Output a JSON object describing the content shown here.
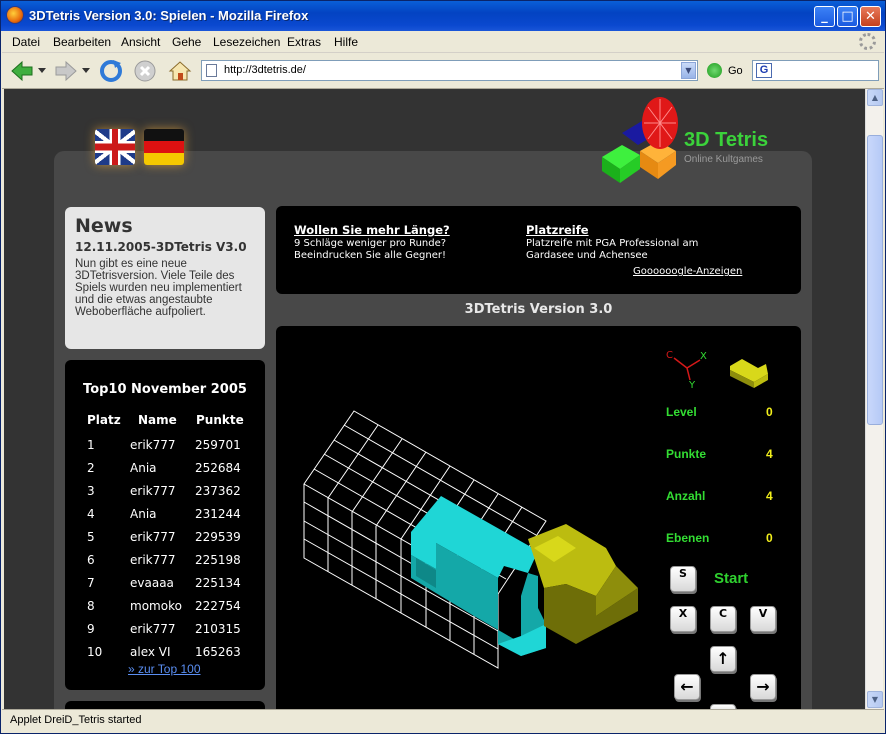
{
  "window": {
    "title": "3DTetris Version 3.0: Spielen - Mozilla Firefox",
    "btn_min": "_",
    "btn_max": "□",
    "btn_close": "✕"
  },
  "menu": [
    "Datei",
    "Bearbeiten",
    "Ansicht",
    "Gehe",
    "Lesezeichen",
    "Extras",
    "Hilfe"
  ],
  "toolbar": {
    "url": "http://3dtetris.de/",
    "go_label": "Go",
    "search_icon_text": "G"
  },
  "status": "Applet DreiD_Tetris started",
  "logo": {
    "title": "3D Tetris",
    "subtitle": "Online Kultgames"
  },
  "news": {
    "heading": "News",
    "date": "12.11.2005-3DTetris V3.0",
    "body": "Nun gibt es eine neue 3DTetrisversion. Viele Teile des Spiels wurden neu implementiert und die etwas angestaubte Weboberfläche aufpoliert."
  },
  "top10": {
    "heading": "Top10 November 2005",
    "columns": [
      "Platz",
      "Name",
      "Punkte"
    ],
    "rows": [
      {
        "rank": "1",
        "name": "erik777",
        "points": "259701"
      },
      {
        "rank": "2",
        "name": "Ania",
        "points": "252684"
      },
      {
        "rank": "3",
        "name": "erik777",
        "points": "237362"
      },
      {
        "rank": "4",
        "name": "Ania",
        "points": "231244"
      },
      {
        "rank": "5",
        "name": "erik777",
        "points": "229539"
      },
      {
        "rank": "6",
        "name": "erik777",
        "points": "225198"
      },
      {
        "rank": "7",
        "name": "evaaaa",
        "points": "225134"
      },
      {
        "rank": "8",
        "name": "momoko",
        "points": "222754"
      },
      {
        "rank": "9",
        "name": "erik777",
        "points": "210315"
      },
      {
        "rank": "10",
        "name": "alex VI",
        "points": "165263"
      }
    ],
    "link": "» zur Top 100"
  },
  "ads": {
    "ad1_title": "Wollen Sie mehr Länge?",
    "ad1_line1": "9 Schläge weniger pro Runde?",
    "ad1_line2": "Beeindrucken Sie alle Gegner!",
    "ad2_title": "Platzreife",
    "ad2_line1": "Platzreife mit PGA Professional am",
    "ad2_line2": "Gardasee und Achensee",
    "google": "Goooooogle-Anzeigen"
  },
  "game": {
    "title": "3DTetris Version 3.0",
    "axes": {
      "x": "X",
      "y": "Y",
      "z": "C"
    },
    "stats": [
      {
        "label": "Level",
        "value": "0"
      },
      {
        "label": "Punkte",
        "value": "4"
      },
      {
        "label": "Anzahl",
        "value": "4"
      },
      {
        "label": "Ebenen",
        "value": "0"
      }
    ],
    "start_label": "Start",
    "keys": {
      "s": "S",
      "x": "X",
      "c": "C",
      "v": "V",
      "up": "↑",
      "left": "←",
      "right": "→"
    }
  },
  "colors": {
    "accent_green": "#33dd33",
    "value_yellow": "#f2ef1c",
    "piece_cyan": "#1fbfbf",
    "piece_olive": "#bcbc10"
  }
}
